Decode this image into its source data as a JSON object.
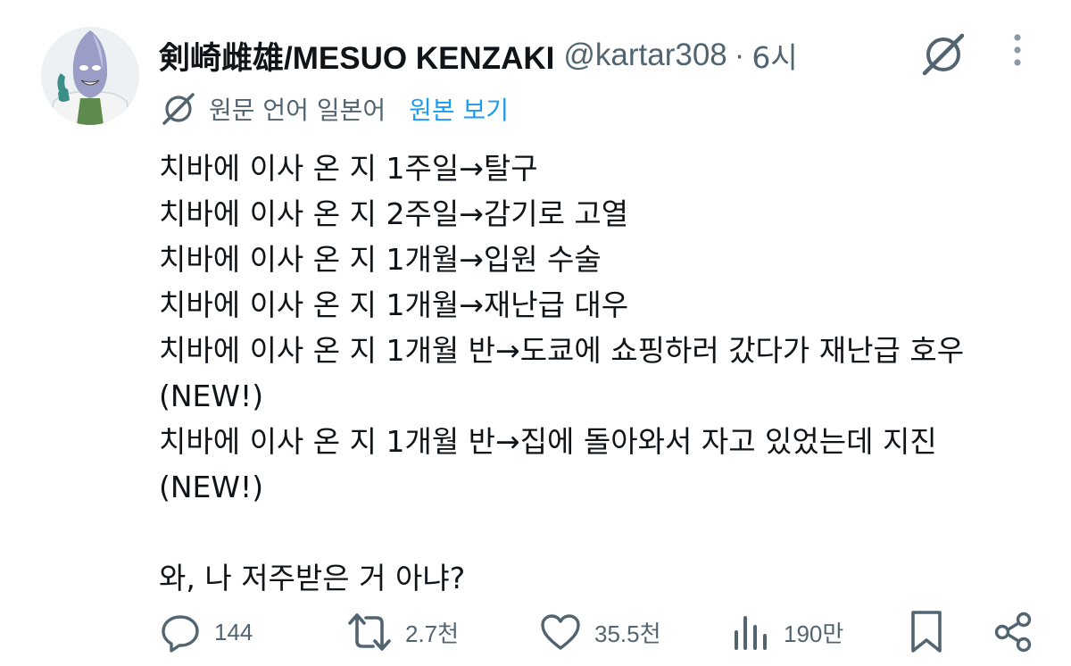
{
  "tweet": {
    "display_name": "剣崎雌雄/MESUO KENZAKI",
    "handle": "@kartar308",
    "separator": "·",
    "time": "6시",
    "translation": {
      "source_language": "원문 언어 일본어",
      "show_original": "원본 보기"
    },
    "lines": [
      "치바에 이사 온 지 1주일→탈구",
      "치바에 이사 온 지 2주일→감기로 고열",
      "치바에 이사 온 지 1개월→입원 수술",
      "치바에 이사 온 지 1개월→재난급 대우",
      "치바에 이사 온 지 1개월 반→도쿄에 쇼핑하러 갔다가 재난급 호우",
      "(NEW!)",
      "치바에 이사 온 지 1개월 반→집에 돌아와서 자고 있었는데 지진",
      "(NEW!)",
      "",
      "와, 나 저주받은 거 아냐?"
    ]
  },
  "actions": {
    "replies": "144",
    "reposts": "2.7천",
    "likes": "35.5천",
    "views": "190만"
  },
  "icons": {
    "grok": "grok-icon",
    "more": "more-vertical-icon",
    "reply": "reply-icon",
    "repost": "repost-icon",
    "like": "heart-icon",
    "views": "views-icon",
    "bookmark": "bookmark-icon",
    "share": "share-icon"
  },
  "colors": {
    "text": "#0f1419",
    "secondary": "#536471",
    "link": "#1d9bf0"
  }
}
